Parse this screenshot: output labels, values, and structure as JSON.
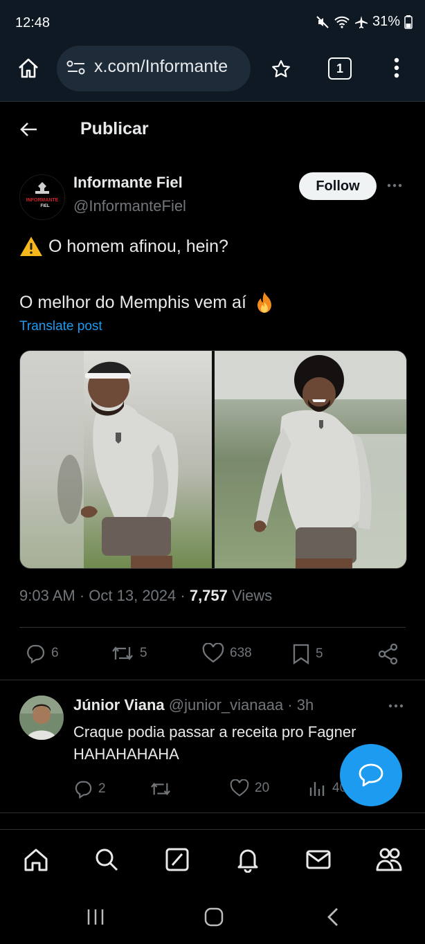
{
  "status_bar": {
    "time": "12:48",
    "battery": "31%"
  },
  "browser": {
    "url": "x.com/Informante",
    "tab_count": "1"
  },
  "header": {
    "title": "Publicar"
  },
  "tweet": {
    "author_name": "Informante Fiel",
    "author_handle": "@InformanteFiel",
    "follow_label": "Follow",
    "avatar_text_top": "INFORMANTE",
    "avatar_text_bottom": "FIEL",
    "text_line1": "O homem afinou, hein?",
    "text_line2": "O melhor do Memphis vem aí",
    "translate_label": "Translate post",
    "time": "9:03 AM",
    "date": "Oct 13, 2024",
    "views_count": "7,757",
    "views_label": "Views",
    "stats": {
      "replies": "6",
      "reposts": "5",
      "likes": "638",
      "bookmarks": "5"
    }
  },
  "reply": {
    "author_name": "Júnior Viana",
    "author_handle": "@junior_vianaaa",
    "age": "3h",
    "text": "Craque podia passar a receita pro Fagner HAHAHAHAHA",
    "stats": {
      "replies": "2",
      "likes": "20",
      "views": "40"
    }
  },
  "colors": {
    "accent": "#1d9bf0",
    "background": "#000000",
    "muted": "#71767b"
  },
  "icons": [
    "back-arrow-icon",
    "home-icon",
    "search-icon",
    "compose-icon",
    "bell-icon",
    "mail-icon",
    "communities-icon",
    "reply-icon",
    "repost-icon",
    "like-icon",
    "bookmark-icon",
    "share-icon",
    "views-icon",
    "fire-emoji",
    "warning-emoji"
  ]
}
